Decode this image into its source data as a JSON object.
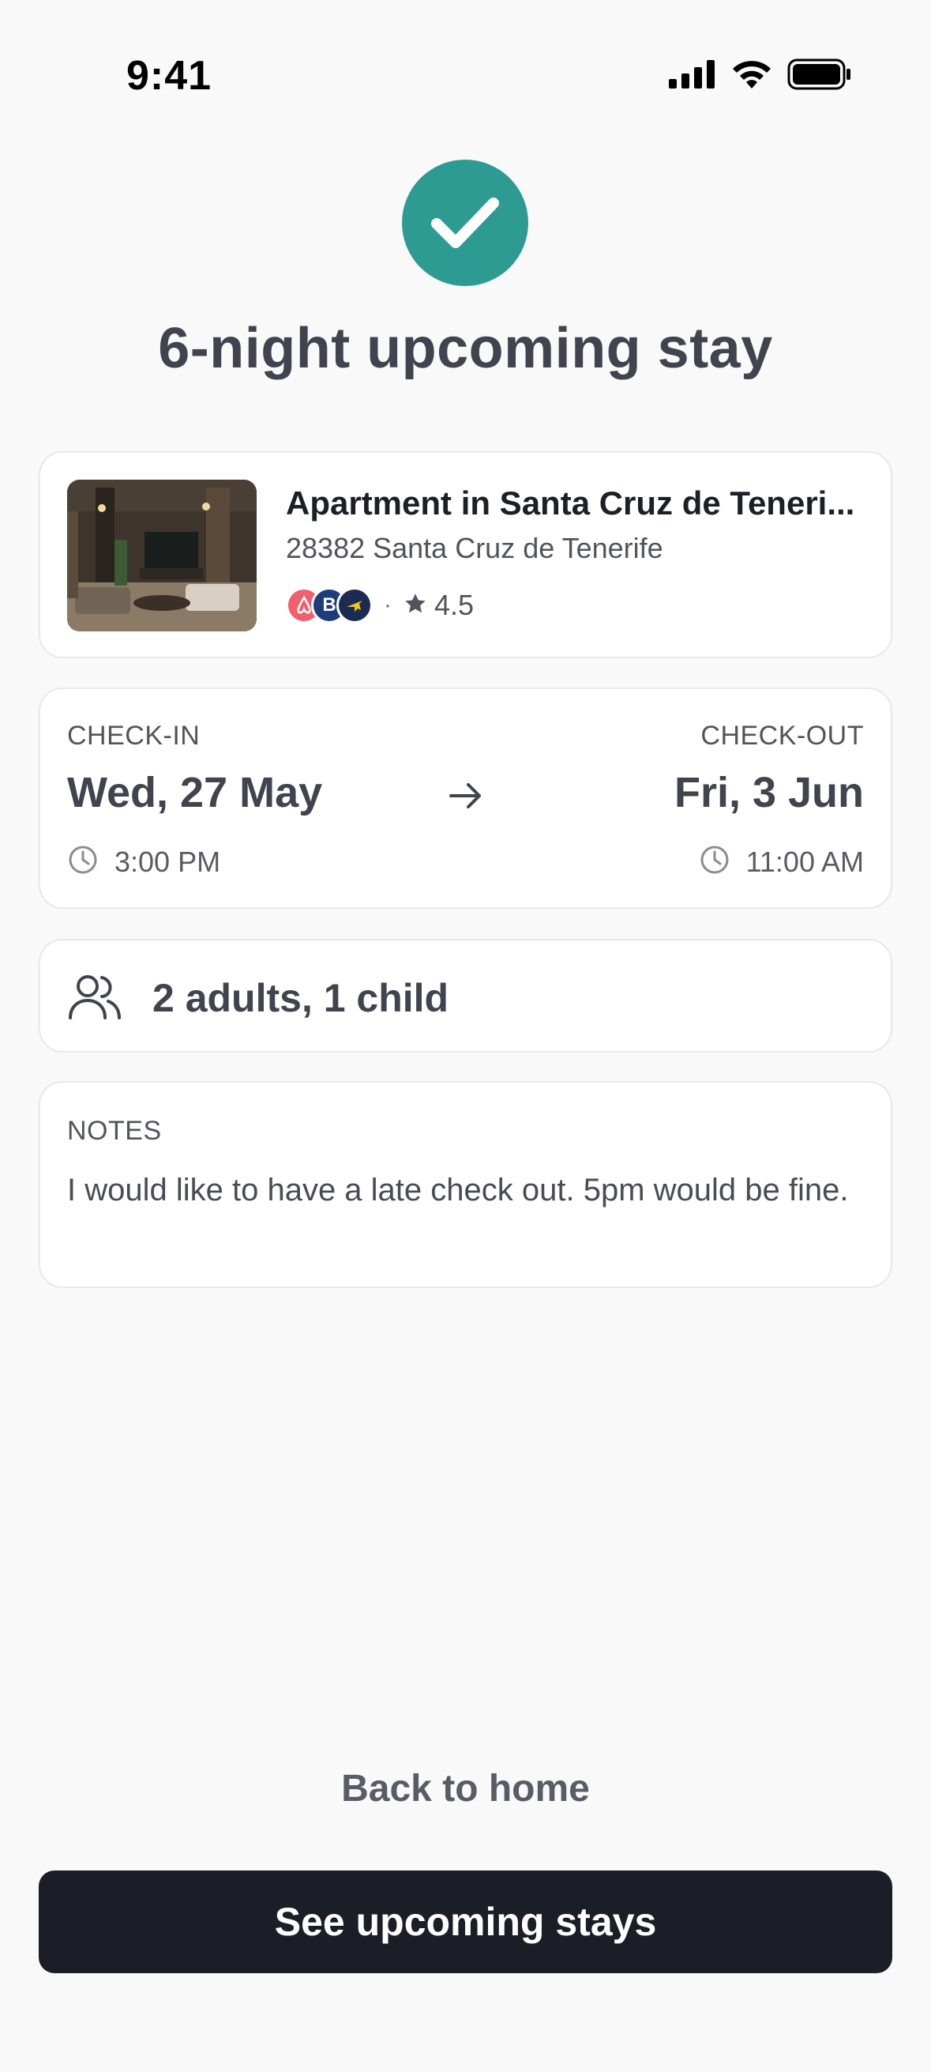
{
  "status_bar": {
    "time": "9:41",
    "icons": [
      "signal-icon",
      "wifi-icon",
      "battery-icon"
    ]
  },
  "header": {
    "icon": "checkmark-icon",
    "accent_color": "#2e9b93",
    "title": "6-night upcoming stay"
  },
  "property": {
    "title": "Apartment in Santa Cruz de Teneri...",
    "address": "28382 Santa Cruz de Tenerife",
    "platforms": [
      {
        "name": "airbnb-logo-icon",
        "color": "#f0606b"
      },
      {
        "name": "booking-logo-icon",
        "color": "#1f3d7a",
        "glyph": "B"
      },
      {
        "name": "expedia-logo-icon",
        "color": "#1b2b54"
      }
    ],
    "separator": "·",
    "rating": "4.5"
  },
  "stay": {
    "checkin_label": "CHECK-IN",
    "checkin_date": "Wed, 27 May",
    "checkin_time": "3:00 PM",
    "checkout_label": "CHECK-OUT",
    "checkout_date": "Fri, 3 Jun",
    "checkout_time": "11:00 AM"
  },
  "guests": {
    "text": "2 adults, 1 child"
  },
  "notes": {
    "label": "NOTES",
    "text": "I would like to have a late check out. 5pm would be fine."
  },
  "actions": {
    "back_label": "Back to home",
    "primary_label": "See upcoming stays"
  }
}
